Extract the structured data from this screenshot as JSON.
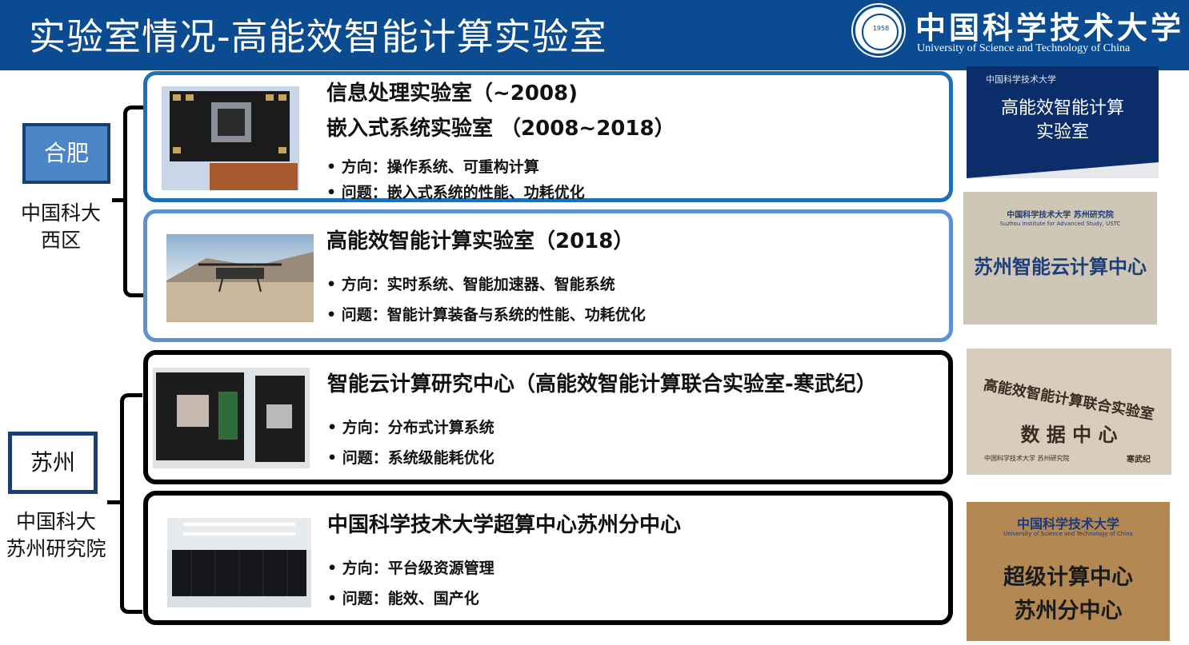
{
  "header": {
    "title": "实验室情况-高能效智能计算实验室",
    "logo_cn": "中国科学技术大学",
    "logo_en": "University of Science and Technology of China",
    "logo_year": "1958"
  },
  "campuses": [
    {
      "tag": "合肥",
      "subtitle_line1": "中国科大",
      "subtitle_line2": "西区"
    },
    {
      "tag": "苏州",
      "subtitle_line1": "中国科大",
      "subtitle_line2": "苏州研究院"
    }
  ],
  "labs": [
    {
      "title": "信息处理实验室（~2008)",
      "title2": "嵌入式系统实验室 （2008~2018）",
      "direction": "• 方向：操作系统、可重构计算",
      "problem": "• 问题：嵌入式系统的性能、功耗优化",
      "image": "gpu-board-image",
      "border_color": "#1f6fb6"
    },
    {
      "title": "高能效智能计算实验室（2018）",
      "direction": "• 方向：实时系统、智能加速器、智能系统",
      "problem": "• 问题：智能计算装备与系统的性能、功耗优化",
      "image": "drone-image",
      "border_color": "#5b92cf"
    },
    {
      "title": "智能云计算研究中心（高能效智能计算联合实验室-寒武纪）",
      "direction": "• 方向：分布式计算系统",
      "problem": "• 问题：系统级能耗优化",
      "image": "accelerator-board-image",
      "border_color": "#000000"
    },
    {
      "title": "中国科学技术大学超算中心苏州分中心",
      "direction": "• 方向：平台级资源管理",
      "problem": "• 问题：能效、国产化",
      "image": "datacenter-image",
      "border_color": "#000000"
    }
  ],
  "signs": [
    {
      "header": "中国科学技术大学",
      "lines": [
        "高能效智能计算",
        "实验室"
      ]
    },
    {
      "header": "中国科学技术大学 苏州研究院",
      "subheader": "Suzhou Institute for Advanced Study, USTC",
      "lines": [
        "苏州智能云计算中心"
      ]
    },
    {
      "lines": [
        "高能效智能计算联合实验室",
        "数 据 中 心"
      ],
      "footer_left": "中国科学技术大学 苏州研究院",
      "footer_right": "寒武纪"
    },
    {
      "header": "中国科学技术大学",
      "subheader": "University of Science and Technology of China",
      "lines": [
        "超级计算中心",
        "苏州分中心"
      ]
    }
  ]
}
